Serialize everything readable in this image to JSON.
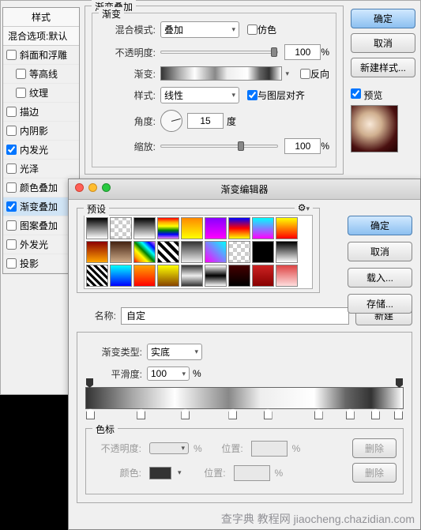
{
  "bg_dialog": {
    "styles_header": "样式",
    "blend_header": "混合选项:默认",
    "items": [
      {
        "label": "斜面和浮雕",
        "checked": false
      },
      {
        "label": "等高线",
        "checked": false,
        "indent": true
      },
      {
        "label": "纹理",
        "checked": false,
        "indent": true
      },
      {
        "label": "描边",
        "checked": false
      },
      {
        "label": "内阴影",
        "checked": false
      },
      {
        "label": "内发光",
        "checked": true
      },
      {
        "label": "光泽",
        "checked": false
      },
      {
        "label": "颜色叠加",
        "checked": false
      },
      {
        "label": "渐变叠加",
        "checked": true,
        "selected": true
      },
      {
        "label": "图案叠加",
        "checked": false
      },
      {
        "label": "外发光",
        "checked": false
      },
      {
        "label": "投影",
        "checked": false
      }
    ],
    "panel": {
      "group_title": "渐变叠加",
      "inner_title": "渐变",
      "blend_mode_label": "混合模式:",
      "blend_mode_value": "叠加",
      "dither_label": "仿色",
      "opacity_label": "不透明度:",
      "opacity_value": "100",
      "percent": "%",
      "gradient_label": "渐变:",
      "reverse_label": "反向",
      "style_label": "样式:",
      "style_value": "线性",
      "align_label": "与图层对齐",
      "angle_label": "角度:",
      "angle_value": "15",
      "degree": "度",
      "scale_label": "缩放:",
      "scale_value": "100"
    },
    "buttons": {
      "ok": "确定",
      "cancel": "取消",
      "new_style": "新建样式...",
      "preview": "预览"
    }
  },
  "editor": {
    "title": "渐变编辑器",
    "presets_label": "预设",
    "gear_icon": "⚙",
    "buttons": {
      "ok": "确定",
      "cancel": "取消",
      "load": "载入...",
      "save": "存储..."
    },
    "name_label": "名称:",
    "name_value": "自定",
    "new_btn": "新建",
    "grad_type_label": "渐变类型:",
    "grad_type_value": "实底",
    "smoothness_label": "平滑度:",
    "smoothness_value": "100",
    "percent": "%",
    "stops_label": "色标",
    "stop_opacity_label": "不透明度:",
    "position_label": "位置:",
    "delete_btn": "删除",
    "color_label": "颜色:"
  },
  "watermark": "查字典 教程网\njiaocheng.chazidian.com"
}
